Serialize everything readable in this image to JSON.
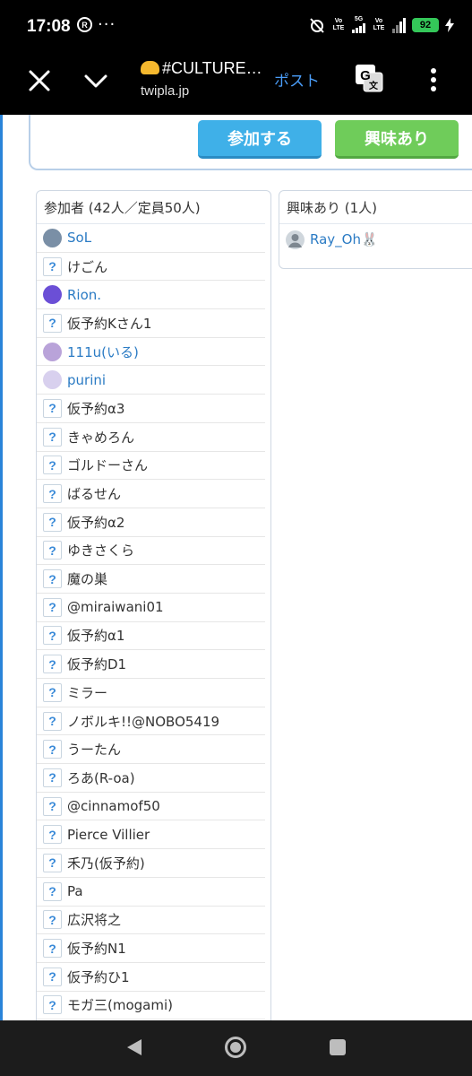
{
  "status": {
    "time": "17:08",
    "left_icons": [
      "r-circle-icon",
      "more-dots-icon"
    ],
    "network_5g": "5G",
    "volte": "Vo LTE",
    "battery": "92"
  },
  "browser": {
    "page_title": "#CULTURE…",
    "host": "twipla.jp",
    "post_label": "ポスト"
  },
  "actions": {
    "join_label": "参加する",
    "interest_label": "興味あり"
  },
  "participants": {
    "header": "参加者 (42人／定員50人)",
    "items": [
      {
        "name": "SoL",
        "avatar": "photo",
        "color": "#7a8fa6",
        "link": true
      },
      {
        "name": "けごん",
        "avatar": "question"
      },
      {
        "name": "Rion.",
        "avatar": "photo",
        "color": "#6b4fd6",
        "link": true
      },
      {
        "name": "仮予約Kさん1",
        "avatar": "question"
      },
      {
        "name": "111u(いる)",
        "avatar": "photo",
        "color": "#b9a3d9",
        "link": true
      },
      {
        "name": "purini",
        "avatar": "photo",
        "color": "#d8d0ee",
        "link": true
      },
      {
        "name": "仮予約α3",
        "avatar": "question"
      },
      {
        "name": "きゃめろん",
        "avatar": "question"
      },
      {
        "name": "ゴルドーさん",
        "avatar": "question"
      },
      {
        "name": "ばるせん",
        "avatar": "question"
      },
      {
        "name": "仮予約α2",
        "avatar": "question"
      },
      {
        "name": "ゆきさくら",
        "avatar": "question"
      },
      {
        "name": "魔の巣",
        "avatar": "question"
      },
      {
        "name": "@miraiwani01",
        "avatar": "question"
      },
      {
        "name": "仮予約α1",
        "avatar": "question"
      },
      {
        "name": "仮予約D1",
        "avatar": "question"
      },
      {
        "name": "ミラー",
        "avatar": "question"
      },
      {
        "name": "ノボルキ!!@NOBO5419",
        "avatar": "question"
      },
      {
        "name": "うーたん",
        "avatar": "question"
      },
      {
        "name": "ろあ(R-oa)",
        "avatar": "question"
      },
      {
        "name": "@cinnamof50",
        "avatar": "question"
      },
      {
        "name": "Pierce Villier",
        "avatar": "question"
      },
      {
        "name": "禾乃(仮予約)",
        "avatar": "question"
      },
      {
        "name": "Pa",
        "avatar": "question"
      },
      {
        "name": "広沢将之",
        "avatar": "question"
      },
      {
        "name": "仮予約N1",
        "avatar": "question"
      },
      {
        "name": "仮予約ひ1",
        "avatar": "question"
      },
      {
        "name": "モガ三(mogami)",
        "avatar": "question"
      }
    ]
  },
  "interested": {
    "header": "興味あり (1人)",
    "items": [
      {
        "name": "Ray_Oh🐰",
        "avatar": "default-user",
        "color": "#9aa4ad",
        "link": true
      }
    ]
  },
  "nav": {
    "icons": [
      "back-icon",
      "home-icon",
      "recent-apps-icon"
    ]
  }
}
